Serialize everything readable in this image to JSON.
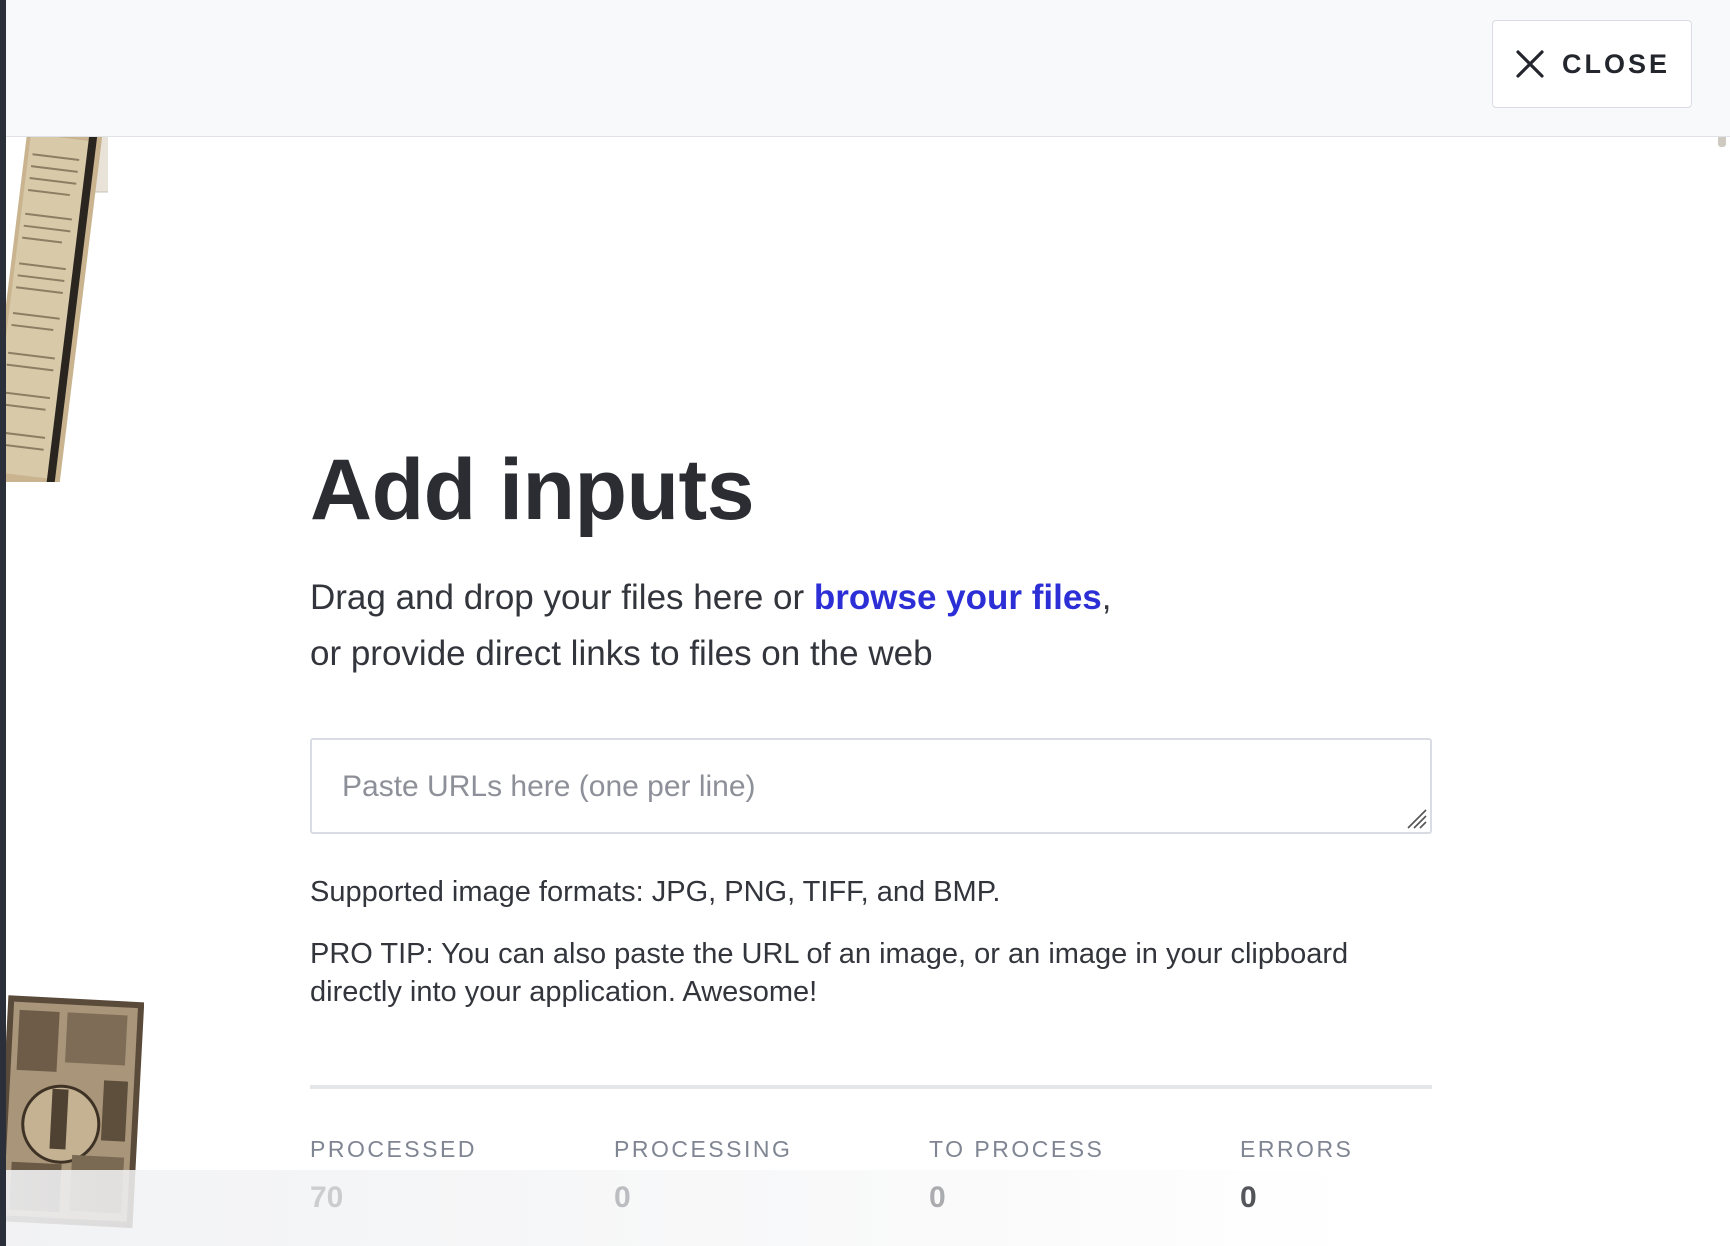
{
  "header": {
    "close_label": "CLOSE",
    "close_icon": "close-icon"
  },
  "main": {
    "title": "Add inputs",
    "intro_prefix": "Drag and drop your files here or ",
    "browse_link": "browse your files",
    "intro_comma": ",",
    "intro_line2": "or provide direct links to files on the web",
    "url_placeholder": "Paste URLs here (one per line)",
    "formats_note": "Supported image formats: JPG, PNG, TIFF, and BMP.",
    "pro_tip": "PRO TIP: You can also paste the URL of an image, or an image in your clipboard directly into your application. Awesome!"
  },
  "stats": [
    {
      "label": "PROCESSED",
      "value": "70"
    },
    {
      "label": "PROCESSING",
      "value": "0"
    },
    {
      "label": "TO PROCESS",
      "value": "0"
    },
    {
      "label": "ERRORS",
      "value": "0"
    }
  ],
  "colors": {
    "link": "#2d2fd6",
    "text": "#2b2d33",
    "muted": "#7f8592",
    "border": "#d9dce2",
    "header_bg": "#f8f9fb"
  }
}
